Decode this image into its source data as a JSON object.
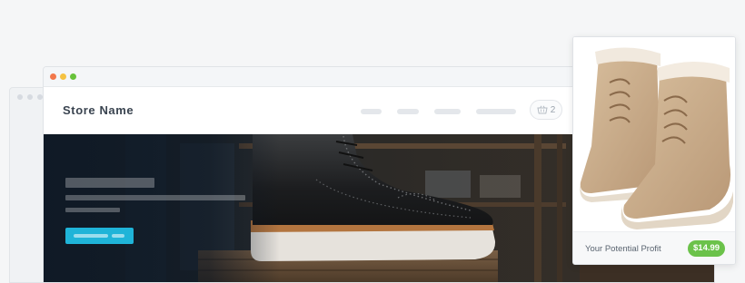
{
  "store": {
    "name": "Store Name",
    "cart_count": "2"
  },
  "window": {
    "dot_colors": [
      "#f2784b",
      "#f5c242",
      "#67c23a"
    ]
  },
  "product_card": {
    "profit_label": "Your Potential Profit",
    "price": "$14.99"
  },
  "colors": {
    "accent": "#1fb4d8",
    "profit_green": "#6bc24a"
  },
  "icons": {
    "cart": "basket-icon"
  }
}
